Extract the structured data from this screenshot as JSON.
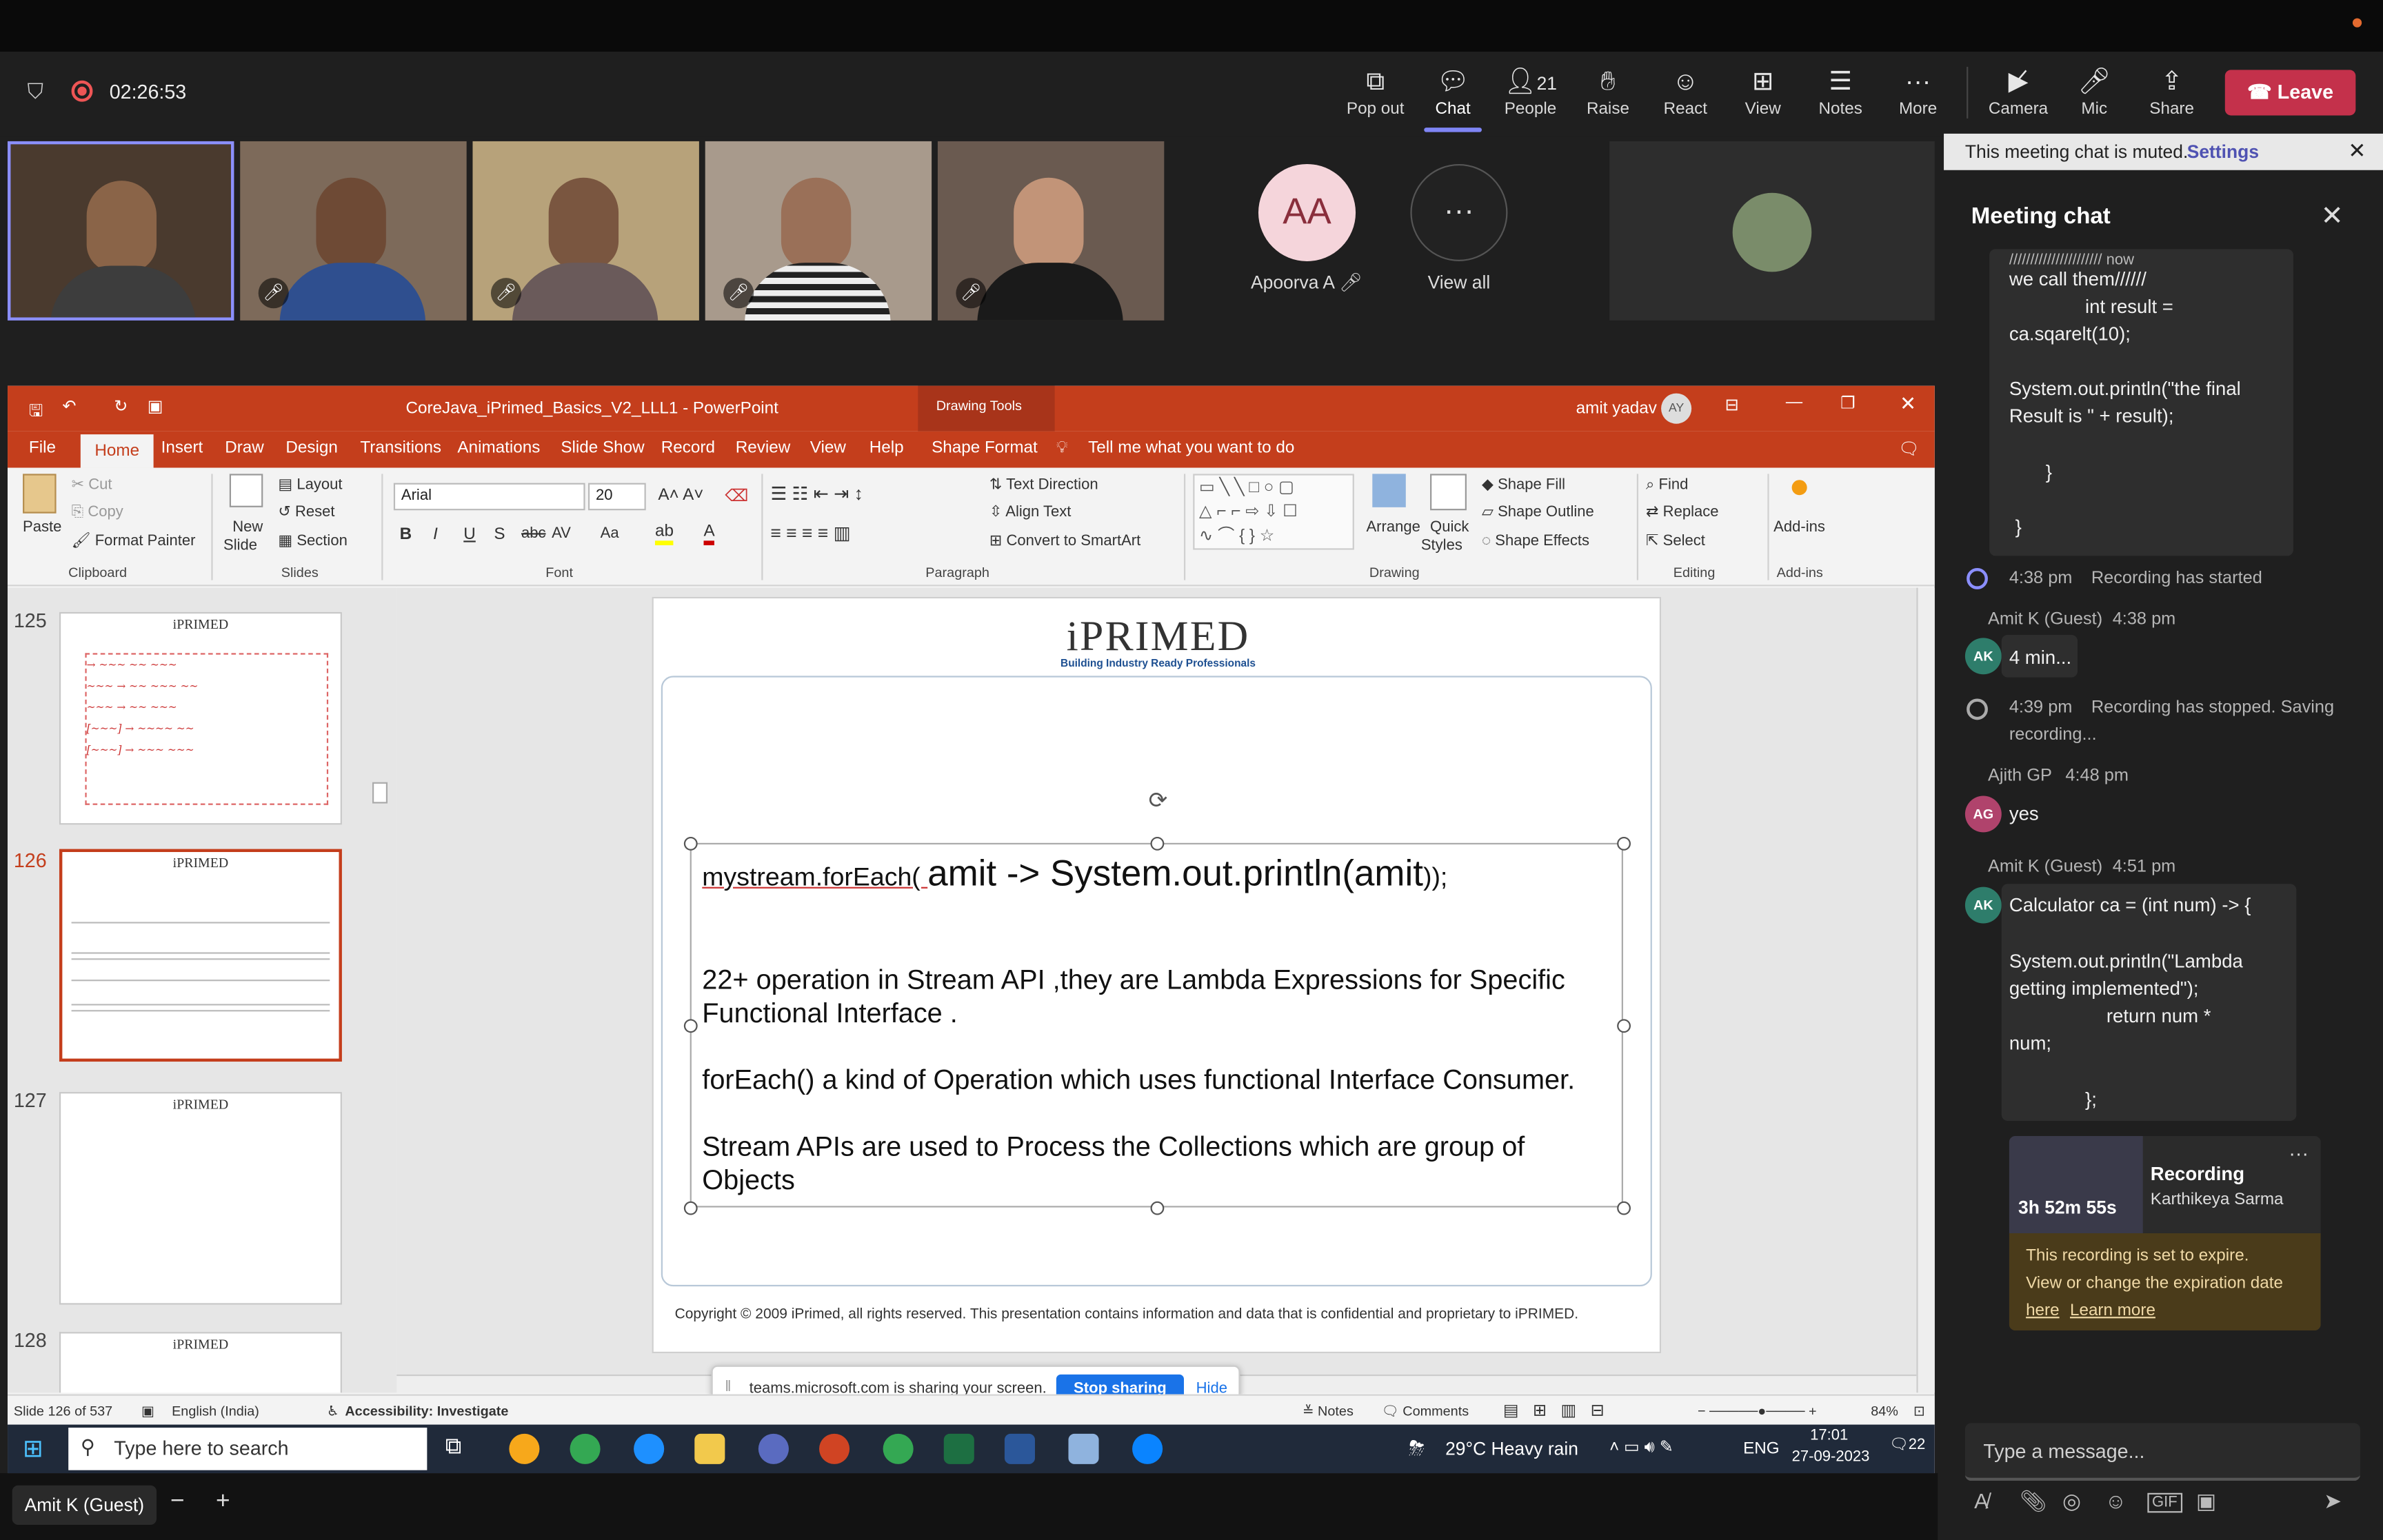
{
  "meeting": {
    "timer": "02:26:53",
    "controls": {
      "popout": "Pop out",
      "chat": "Chat",
      "people": "People",
      "people_count": "21",
      "raise": "Raise",
      "react": "React",
      "view": "View",
      "notes": "Notes",
      "more": "More",
      "camera": "Camera",
      "mic": "Mic",
      "share": "Share",
      "leave": "Leave"
    },
    "participants": {
      "avatar_initials": "AA",
      "avatar_name": "Apoorva A",
      "view_all": "View all"
    },
    "self_label": "Amit K (Guest)"
  },
  "ppt": {
    "title": "CoreJava_iPrimed_Basics_V2_LLL1  -  PowerPoint",
    "drawing_tools": "Drawing Tools",
    "user": "amit yadav",
    "user_initials": "AY",
    "menu": [
      "File",
      "Home",
      "Insert",
      "Draw",
      "Design",
      "Transitions",
      "Animations",
      "Slide Show",
      "Record",
      "Review",
      "View",
      "Help",
      "Shape Format"
    ],
    "tell_me": "Tell me what you want to do",
    "ribbon": {
      "paste": "Paste",
      "cut": "Cut",
      "copy": "Copy",
      "format_painter": "Format Painter",
      "clipboard": "Clipboard",
      "new_slide": "New",
      "new_slide2": "Slide",
      "layout": "Layout",
      "reset": "Reset",
      "section": "Section",
      "slides": "Slides",
      "font_name": "Arial",
      "font_size": "20",
      "font": "Font",
      "text_direction": "Text Direction",
      "align_text": "Align Text",
      "smartart": "Convert to SmartArt",
      "paragraph": "Paragraph",
      "arrange": "Arrange",
      "quick": "Quick",
      "styles": "Styles",
      "shape_fill": "Shape Fill",
      "shape_outline": "Shape Outline",
      "shape_effects": "Shape Effects",
      "drawing": "Drawing",
      "find": "Find",
      "replace": "Replace",
      "select": "Select",
      "editing": "Editing",
      "addins": "Add-ins",
      "addins_group": "Add-ins"
    },
    "thumbs": [
      "125",
      "126",
      "127",
      "128"
    ],
    "slide": {
      "logo": "iPRIMED",
      "logo_sub": "Building Industry Ready Professionals",
      "line1_a": "mystream.forEach( ",
      "line1_b": "amit -> System.out.println(amit",
      "line1_c": "));",
      "line2": "22+ operation in Stream API ,they are Lambda Expressions for Specific",
      "line2b": "Functional Interface .",
      "line3": "forEach() a kind of Operation which uses functional Interface Consumer.",
      "line4": "Stream APIs are used to Process the Collections which are group of",
      "line4b": "Objects",
      "copyright": "Copyright © 2009 iPrimed, all rights reserved. This presentation contains information  and data  that is confidential and proprietary to iPRIMED."
    },
    "status": {
      "slide": "Slide 126 of 537",
      "language": "English (India)",
      "accessibility": "Accessibility: Investigate",
      "notes": "Notes",
      "comments": "Comments",
      "zoom": "84%"
    },
    "sharing": {
      "text": "teams.microsoft.com is sharing your screen.",
      "stop": "Stop sharing",
      "hide": "Hide"
    },
    "taskbar": {
      "search": "Type here to search",
      "weather": "29°C  Heavy rain",
      "lang": "ENG",
      "time": "17:01",
      "date": "27-09-2023",
      "notif": "22"
    }
  },
  "chat": {
    "muted": "This meeting chat is muted.",
    "settings": "Settings",
    "title": "Meeting chat",
    "code_top": [
      "we call them//////",
      "int result =",
      "ca.sqarelt(10);",
      "System.out.println(\"the final",
      "Result is \" + result);",
      "}",
      "}"
    ],
    "sys1_time": "4:38 pm",
    "sys1_text": "Recording has started",
    "msg1_author": "Amit K (Guest)",
    "msg1_time": "4:38 pm",
    "msg1_initials": "AK",
    "msg1_text": "4 min...",
    "sys2_time": "4:39 pm",
    "sys2_text": "Recording has stopped. Saving",
    "sys2_text2": "recording...",
    "msg2_author": "Ajith GP",
    "msg2_time": "4:48 pm",
    "msg2_initials": "AG",
    "msg2_text": "yes",
    "msg3_author": "Amit K (Guest)",
    "msg3_time": "4:51 pm",
    "msg3_initials": "AK",
    "msg3_lines": [
      "Calculator ca = (int num) -> {",
      "System.out.println(\"Lambda",
      "getting implemented\");",
      "return       num *",
      "num;",
      "};"
    ],
    "recording": {
      "title": "Recording",
      "by": "Karthikeya Sarma",
      "duration": "3h 52m 55s",
      "warn1": "This recording is set to expire.",
      "warn2": "View or change the expiration date",
      "here": "here",
      "learn_more": "Learn more"
    },
    "compose_placeholder": "Type a message..."
  }
}
